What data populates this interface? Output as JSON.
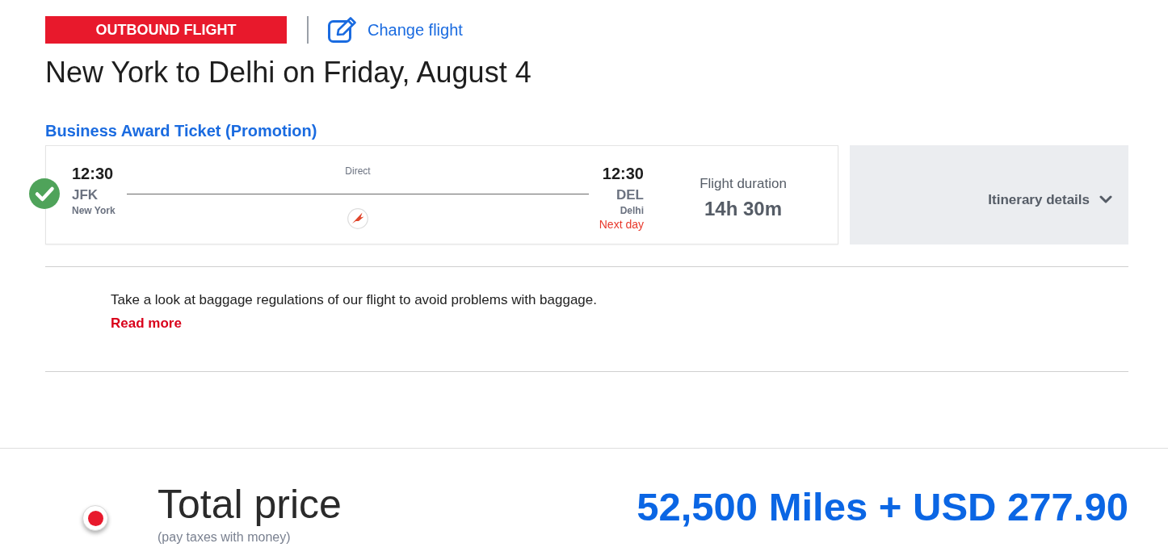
{
  "header": {
    "badge": "OUTBOUND FLIGHT",
    "change_link": "Change flight"
  },
  "title": "New York to Delhi on Friday, August 4",
  "fare_name": "Business Award Ticket (Promotion)",
  "flight": {
    "selected": true,
    "departure": {
      "time": "12:30",
      "code": "JFK",
      "city": "New York"
    },
    "stops": "Direct",
    "arrival": {
      "time": "12:30",
      "code": "DEL",
      "city": "Delhi",
      "day_note": "Next day"
    },
    "duration_label": "Flight duration",
    "duration": "14h 30m"
  },
  "itinerary": {
    "label": "Itinerary details",
    "expanded": false
  },
  "notice": {
    "text": "Take a look at baggage regulations of our flight to avoid problems with baggage.",
    "link": "Read more"
  },
  "total": {
    "selected": true,
    "title": "Total price",
    "subtitle": "(pay taxes with money)",
    "amount": "52,500 Miles + USD 277.90"
  }
}
